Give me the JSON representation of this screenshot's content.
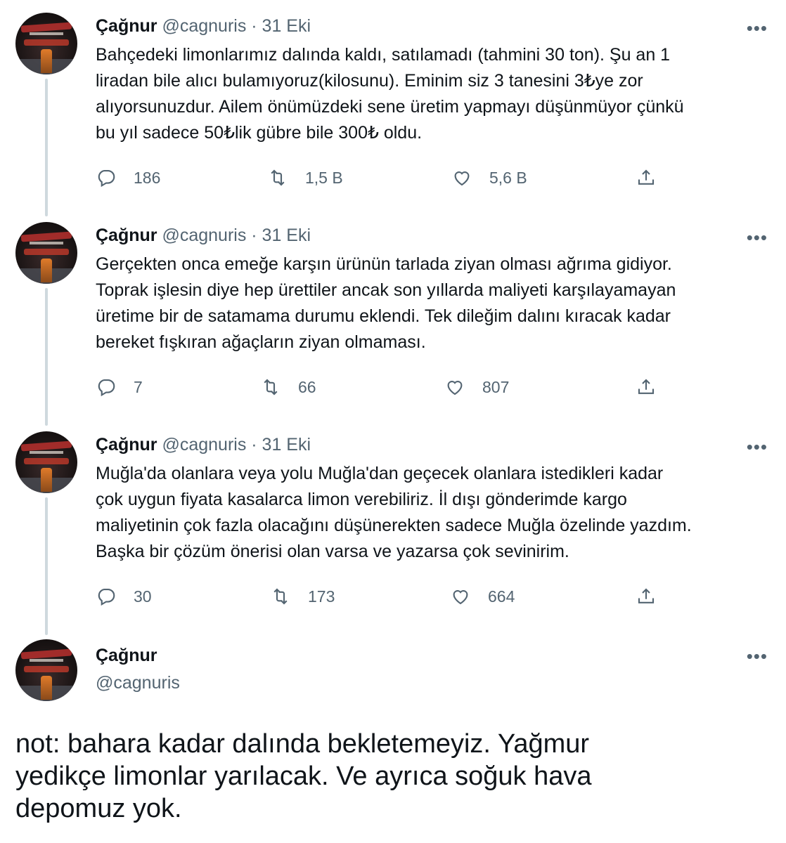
{
  "tweets": [
    {
      "name": "Çağnur",
      "meta": "@cagnuris · 31 Eki",
      "lines": [
        "Bahçedeki limonlarımız dalında kaldı, satılamadı (tahmini 30 ton). Şu an 1",
        "liradan bile alıcı bulamıyoruz(kilosunu). Eminim siz 3 tanesini 3₺ye zor",
        "alıyorsunuzdur. Ailem önümüzdeki sene üretim yapmayı düşünmüyor çünkü",
        "bu yıl sadece 50₺lik gübre bile 300₺ oldu."
      ],
      "replies": "186",
      "retweets": "1,5 B",
      "likes": "5,6 B"
    },
    {
      "name": "Çağnur",
      "meta": "@cagnuris · 31 Eki",
      "lines": [
        "Gerçekten onca emeğe karşın ürünün tarlada ziyan olması ağrıma gidiyor.",
        "Toprak işlesin diye hep ürettiler ancak son yıllarda maliyeti karşılayamayan",
        "üretime bir de satamama durumu eklendi. Tek dileğim dalını kıracak kadar",
        "bereket fışkıran ağaçların ziyan olmaması."
      ],
      "replies": "7",
      "retweets": "66",
      "likes": "807"
    },
    {
      "name": "Çağnur",
      "meta": "@cagnuris · 31 Eki",
      "lines": [
        "Muğla'da olanlara veya yolu Muğla'dan geçecek olanlara istedikleri kadar",
        "çok uygun fiyata kasalarca limon verebiliriz. İl dışı gönderimde kargo",
        "maliyetinin çok fazla olacağını düşünerekten sadece Muğla özelinde yazdım.",
        "Başka bir çözüm önerisi olan varsa ve yazarsa çok sevinirim."
      ],
      "replies": "30",
      "retweets": "173",
      "likes": "664"
    }
  ],
  "last_tweet": {
    "name": "Çağnur",
    "handle": "@cagnuris",
    "lines": [
      "not: bahara kadar dalında bekletemeyiz. Yağmur",
      "yedikçe limonlar yarılacak. Ve ayrıca soğuk hava",
      "depomuz yok."
    ]
  },
  "more_label": "•••",
  "icons": {
    "reply": "reply-icon",
    "retweet": "retweet-icon",
    "like": "heart-icon",
    "share": "share-icon",
    "more": "more-icon"
  },
  "colors": {
    "text": "#0f1419",
    "muted": "#536471",
    "thread_line": "#cfd9de"
  }
}
